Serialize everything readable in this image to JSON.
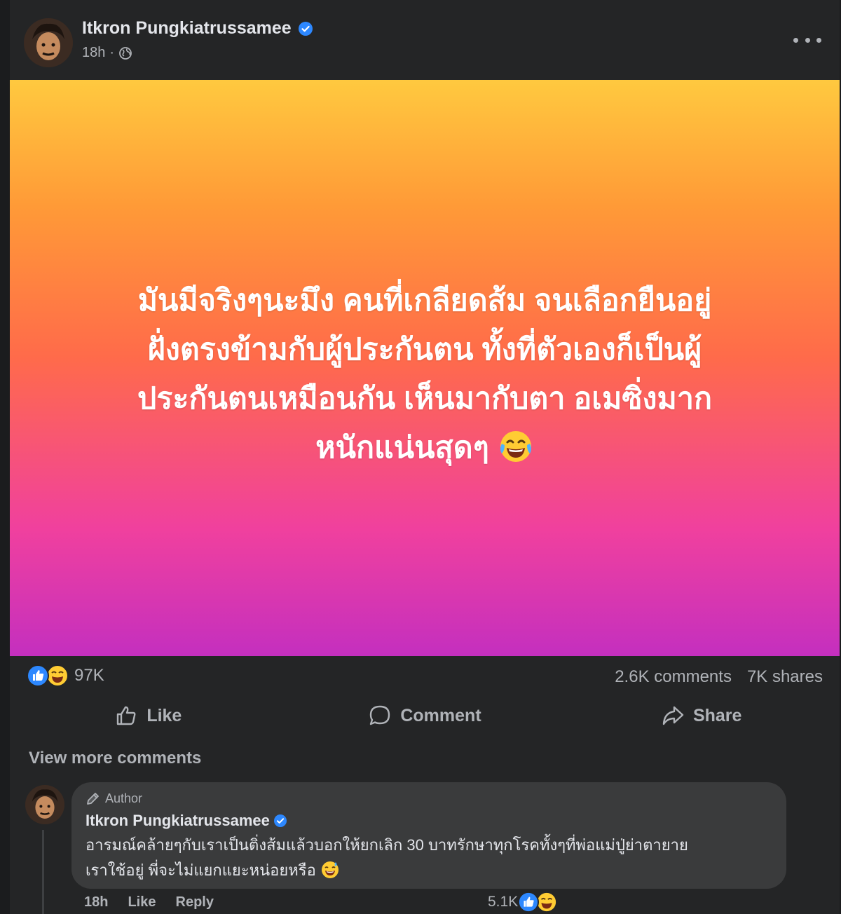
{
  "post": {
    "author": "Itkron Pungkiatrussamee",
    "time": "18h",
    "separator": "·",
    "status_lines": [
      "มันมีจริงๆนะมึง คนที่เกลียดส้ม จนเลือกยืนอยู่",
      "ฝั่งตรงข้ามกับผู้ประกันตน ทั้งที่ตัวเองก็เป็นผู้",
      "ประกันตนเหมือนกัน เห็นมากับตา อเมซิ่งมาก",
      "หนักแน่นสุดๆ"
    ],
    "status_emoji": "laughing-tears-emoji"
  },
  "stats": {
    "reactions_count": "97K",
    "comments": "2.6K comments",
    "shares": "7K shares"
  },
  "actions": {
    "like": "Like",
    "comment": "Comment",
    "share": "Share"
  },
  "view_more": "View more comments",
  "comment": {
    "badge": "Author",
    "author": "Itkron Pungkiatrussamee",
    "text_line1": "อารมณ์คล้ายๆกับเราเป็นติ่งส้มแล้วบอกให้ยกเลิก 30 บาทรักษาทุกโรคทั้งๆที่พ่อแม่ปู่ย่าตายาย",
    "text_line2": "เราใช้อยู่ พี่จะไม่แยกแยะหน่อยหรือ",
    "time": "18h",
    "like": "Like",
    "reply": "Reply",
    "reactions_count": "5.1K"
  },
  "colors": {
    "background": "#242526",
    "verified": "#2d88ff",
    "gradient_top": "#ffc93f",
    "gradient_bottom": "#c42fbf"
  }
}
